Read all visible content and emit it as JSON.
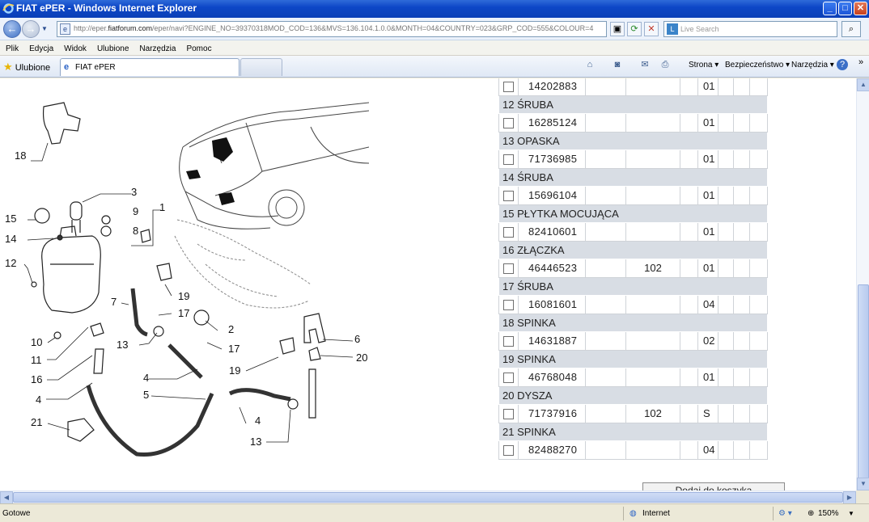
{
  "window": {
    "title": "FIAT ePER - Windows Internet Explorer",
    "buttons": {
      "minimize": "_",
      "maximize": "□",
      "close": "✕"
    }
  },
  "address_bar": {
    "url_prefix": "http://eper.",
    "url_domain": "fiatforum.com",
    "url_rest": "/eper/navi?ENGINE_NO=39370318MOD_COD=136&MVS=136.104.1.0.0&MONTH=04&COUNTRY=023&GRP_COD=555&COLOUR=4",
    "search_placeholder": "Live Search"
  },
  "menu": [
    "Plik",
    "Edycja",
    "Widok",
    "Ulubione",
    "Narzędzia",
    "Pomoc"
  ],
  "favorites": {
    "label": "Ulubione",
    "tab_title": "FIAT ePER",
    "commands": {
      "page": "Strona",
      "safety": "Bezpieczeństwo",
      "tools": "Narzędzia"
    }
  },
  "diagram": {
    "callouts": [
      "18",
      "3",
      "9",
      "1",
      "15",
      "8",
      "14",
      "12",
      "7",
      "19",
      "17",
      "2",
      "10",
      "13",
      "17",
      "6",
      "20",
      "11",
      "4",
      "19",
      "16",
      "5",
      "4",
      "4",
      "21",
      "13"
    ]
  },
  "parts": [
    {
      "pos": "",
      "name": "",
      "part_number": "14202883",
      "model": "",
      "qty": "01"
    },
    {
      "pos": "12",
      "name": "ŚRUBA",
      "part_number": "16285124",
      "model": "",
      "qty": "01"
    },
    {
      "pos": "13",
      "name": "OPASKA",
      "part_number": "71736985",
      "model": "",
      "qty": "01"
    },
    {
      "pos": "14",
      "name": "ŚRUBA",
      "part_number": "15696104",
      "model": "",
      "qty": "01"
    },
    {
      "pos": "15",
      "name": "PŁYTKA MOCUJĄCA",
      "part_number": "82410601",
      "model": "",
      "qty": "01"
    },
    {
      "pos": "16",
      "name": "ZŁĄCZKA",
      "part_number": "46446523",
      "model": "102",
      "qty": "01"
    },
    {
      "pos": "17",
      "name": "ŚRUBA",
      "part_number": "16081601",
      "model": "",
      "qty": "04"
    },
    {
      "pos": "18",
      "name": "SPINKA",
      "part_number": "14631887",
      "model": "",
      "qty": "02"
    },
    {
      "pos": "19",
      "name": "SPINKA",
      "part_number": "46768048",
      "model": "",
      "qty": "01"
    },
    {
      "pos": "20",
      "name": "DYSZA",
      "part_number": "71737916",
      "model": "102",
      "qty": "S"
    },
    {
      "pos": "21",
      "name": "SPINKA",
      "part_number": "82488270",
      "model": "",
      "qty": "04"
    }
  ],
  "add_button_label": "Dodaj do koszyka",
  "status": {
    "left": "Gotowe",
    "zone": "Internet",
    "zoom": "150%"
  }
}
